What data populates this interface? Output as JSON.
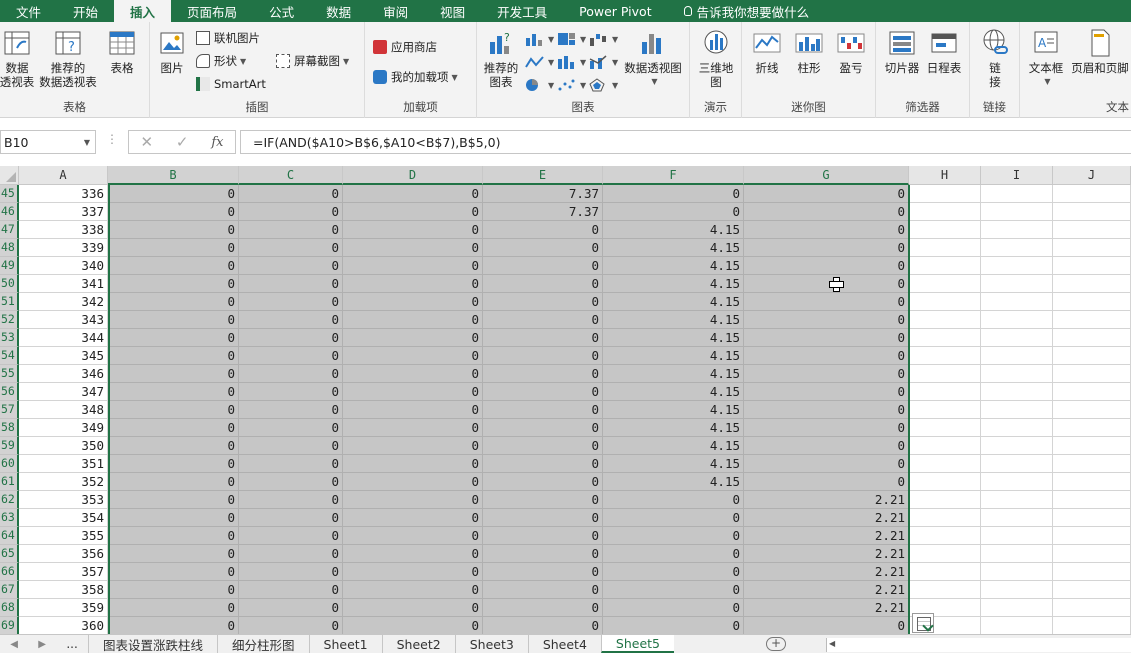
{
  "tabs": [
    "文件",
    "开始",
    "插入",
    "页面布局",
    "公式",
    "数据",
    "审阅",
    "视图",
    "开发工具",
    "Power Pivot"
  ],
  "active_tab": "插入",
  "tell_me": "告诉我你想要做什么",
  "ribbon": {
    "groups": {
      "tables": "表格",
      "illustrations": "插图",
      "addins": "加载项",
      "charts": "图表",
      "tours": "演示",
      "sparklines": "迷你图",
      "filters": "筛选器",
      "links": "链接",
      "text": "文本"
    },
    "pivot_table": "数据\n透视表",
    "recommended_pivot": "推荐的\n数据透视表",
    "table": "表格",
    "picture": "图片",
    "online_picture": "联机图片",
    "shapes": "形状",
    "smartart": "SmartArt",
    "screenshot": "屏幕截图",
    "store": "应用商店",
    "my_addins": "我的加载项",
    "recommended_charts": "推荐的\n图表",
    "pivot_chart": "数据透视图",
    "map_3d": "三维地\n图",
    "line": "折线",
    "column": "柱形",
    "win_loss": "盈亏",
    "slicer": "切片器",
    "timeline": "日程表",
    "link": "链\n接",
    "textbox": "文本框",
    "header_footer": "页眉和页脚"
  },
  "formula_bar": {
    "name_box": "B10",
    "formula": "=IF(AND($A10>B$6,$A10<B$7),B$5,0)",
    "fx": "fx"
  },
  "columns": [
    "A",
    "B",
    "C",
    "D",
    "E",
    "F",
    "G",
    "H",
    "I",
    "J"
  ],
  "selected_columns": [
    "B",
    "C",
    "D",
    "E",
    "F",
    "G"
  ],
  "rows": [
    {
      "row": "45",
      "cells": [
        "336",
        "0",
        "0",
        "0",
        "7.37",
        "0",
        "0"
      ]
    },
    {
      "row": "46",
      "cells": [
        "337",
        "0",
        "0",
        "0",
        "7.37",
        "0",
        "0"
      ]
    },
    {
      "row": "47",
      "cells": [
        "338",
        "0",
        "0",
        "0",
        "0",
        "4.15",
        "0"
      ]
    },
    {
      "row": "48",
      "cells": [
        "339",
        "0",
        "0",
        "0",
        "0",
        "4.15",
        "0"
      ]
    },
    {
      "row": "49",
      "cells": [
        "340",
        "0",
        "0",
        "0",
        "0",
        "4.15",
        "0"
      ]
    },
    {
      "row": "50",
      "cells": [
        "341",
        "0",
        "0",
        "0",
        "0",
        "4.15",
        "0"
      ]
    },
    {
      "row": "51",
      "cells": [
        "342",
        "0",
        "0",
        "0",
        "0",
        "4.15",
        "0"
      ]
    },
    {
      "row": "52",
      "cells": [
        "343",
        "0",
        "0",
        "0",
        "0",
        "4.15",
        "0"
      ]
    },
    {
      "row": "53",
      "cells": [
        "344",
        "0",
        "0",
        "0",
        "0",
        "4.15",
        "0"
      ]
    },
    {
      "row": "54",
      "cells": [
        "345",
        "0",
        "0",
        "0",
        "0",
        "4.15",
        "0"
      ]
    },
    {
      "row": "55",
      "cells": [
        "346",
        "0",
        "0",
        "0",
        "0",
        "4.15",
        "0"
      ]
    },
    {
      "row": "56",
      "cells": [
        "347",
        "0",
        "0",
        "0",
        "0",
        "4.15",
        "0"
      ]
    },
    {
      "row": "57",
      "cells": [
        "348",
        "0",
        "0",
        "0",
        "0",
        "4.15",
        "0"
      ]
    },
    {
      "row": "58",
      "cells": [
        "349",
        "0",
        "0",
        "0",
        "0",
        "4.15",
        "0"
      ]
    },
    {
      "row": "59",
      "cells": [
        "350",
        "0",
        "0",
        "0",
        "0",
        "4.15",
        "0"
      ]
    },
    {
      "row": "60",
      "cells": [
        "351",
        "0",
        "0",
        "0",
        "0",
        "4.15",
        "0"
      ]
    },
    {
      "row": "61",
      "cells": [
        "352",
        "0",
        "0",
        "0",
        "0",
        "4.15",
        "0"
      ]
    },
    {
      "row": "62",
      "cells": [
        "353",
        "0",
        "0",
        "0",
        "0",
        "0",
        "2.21"
      ]
    },
    {
      "row": "63",
      "cells": [
        "354",
        "0",
        "0",
        "0",
        "0",
        "0",
        "2.21"
      ]
    },
    {
      "row": "64",
      "cells": [
        "355",
        "0",
        "0",
        "0",
        "0",
        "0",
        "2.21"
      ]
    },
    {
      "row": "65",
      "cells": [
        "356",
        "0",
        "0",
        "0",
        "0",
        "0",
        "2.21"
      ]
    },
    {
      "row": "66",
      "cells": [
        "357",
        "0",
        "0",
        "0",
        "0",
        "0",
        "2.21"
      ]
    },
    {
      "row": "67",
      "cells": [
        "358",
        "0",
        "0",
        "0",
        "0",
        "0",
        "2.21"
      ]
    },
    {
      "row": "68",
      "cells": [
        "359",
        "0",
        "0",
        "0",
        "0",
        "0",
        "2.21"
      ]
    },
    {
      "row": "69",
      "cells": [
        "360",
        "0",
        "0",
        "0",
        "0",
        "0",
        "0"
      ]
    }
  ],
  "sheets": [
    "图表设置涨跌柱线",
    "细分柱形图",
    "Sheet1",
    "Sheet2",
    "Sheet3",
    "Sheet4",
    "Sheet5"
  ],
  "active_sheet": "Sheet5",
  "sheet_nav_more": "...",
  "colors": {
    "accent": "#217346",
    "selection": "#c6c6c6"
  }
}
